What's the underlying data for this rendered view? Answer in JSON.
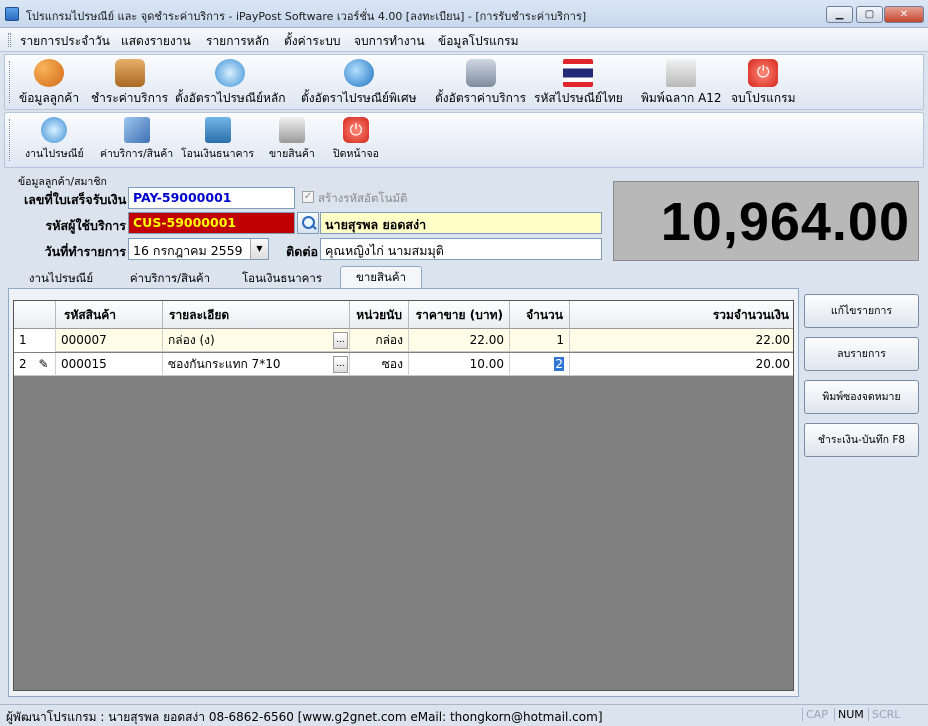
{
  "window": {
    "title": "โปรแกรมไปรษณีย์ และ จุดชำระค่าบริการ - iPayPost Software เวอร์ชั่น 4.00 [ลงทะเบียน] - [การรับชำระค่าบริการ]",
    "min_label": "▁",
    "max_label": "▢",
    "close_label": "✕"
  },
  "menu": [
    "รายการประจำวัน",
    "แสดงรายงาน",
    "รายการหลัก",
    "ตั้งค่าระบบ",
    "จบการทำงาน",
    "ข้อมูลโปรแกรม"
  ],
  "toolbar1": [
    {
      "label": "ข้อมูลลูกค้า",
      "icon": "customers-icon"
    },
    {
      "label": "ชำระค่าบริการ",
      "icon": "book-icon"
    },
    {
      "label": "ตั้งอัตราไปรษณีย์หลัก",
      "icon": "mail-icon"
    },
    {
      "label": "ตั้งอัตราไปรษณีย์พิเศษ",
      "icon": "globe-mail-icon"
    },
    {
      "label": "ตั้งอัตราค่าบริการ",
      "icon": "tap-icon"
    },
    {
      "label": "รหัสไปรษณีย์ไทย",
      "icon": "thai-flag-icon"
    },
    {
      "label": "พิมพ์ฉลาก A12",
      "icon": "envelope-icon"
    },
    {
      "label": "จบโปรแกรม",
      "icon": "power-icon"
    }
  ],
  "toolbar2": [
    {
      "label": "งานไปรษณีย์",
      "icon": "mail-icon"
    },
    {
      "label": "ค่าบริการ/สินค้า",
      "icon": "pencil-icon"
    },
    {
      "label": "โอนเงินธนาคาร",
      "icon": "network-icon"
    },
    {
      "label": "ขายสินค้า",
      "icon": "shop-icon"
    },
    {
      "label": "ปิดหน้าจอ",
      "icon": "power-icon"
    }
  ],
  "form": {
    "group_label": "ข้อมูลลูกค้า/สมาชิก",
    "receipt_label": "เลขที่ใบเสร็จรับเงิน",
    "receipt_value": "PAY-59000001",
    "auto_code_label": "สร้างรหัสอัตโนมัติ",
    "auto_code_checked": "✓",
    "customer_code_label": "รหัสผู้ใช้บริการ",
    "customer_code_value": "CUS-59000001",
    "customer_name": "นายสุรพล ยอดสง่า",
    "date_label": "วันที่ทำรายการ",
    "date_value": "16  กรกฎาคม   2559",
    "contact_label": "ติดต่อ",
    "contact_value": "คุณหญิงไก่ นามสมมุติ"
  },
  "total": "10,964.00",
  "tabs": [
    "งานไปรษณีย์",
    "ค่าบริการ/สินค้า",
    "โอนเงินธนาคาร",
    "ขายสินค้า"
  ],
  "active_tab": 3,
  "grid": {
    "columns": [
      "รหัสสินค้า",
      "รายละเอียด",
      "หน่วยนับ",
      "ราคาขาย (บาท)",
      "จำนวน",
      "รวมจำนวนเงิน"
    ],
    "rows": [
      {
        "no": "1",
        "edit_mark": "",
        "code": "000007",
        "desc": "กล่อง (ง)",
        "unit": "กล่อง",
        "price": "22.00",
        "qty": "1",
        "amount": "22.00"
      },
      {
        "no": "2",
        "edit_mark": "✎",
        "code": "000015",
        "desc": "ซองกันกระแทก 7*10",
        "unit": "ซอง",
        "price": "10.00",
        "qty": "2",
        "amount": "20.00"
      }
    ],
    "ellipsis": "..."
  },
  "side_buttons": [
    {
      "label": "แก้ไขรายการ"
    },
    {
      "label": "ลบรายการ"
    },
    {
      "label": "พิมพ์ซองจดหมาย"
    },
    {
      "label": "ชำระเงิน-บันทึก F8"
    }
  ],
  "status": {
    "text": "ผู้พัฒนาโปรแกรม : นายสุรพล ยอดสง่า 08-6862-6560  [www.g2gnet.com  eMail: thongkorn@hotmail.com]",
    "caps": "CAP",
    "num": "NUM",
    "scrl": "SCRL"
  },
  "colors": {
    "receipt_text": "#0000cc",
    "customer_code_bg": "#c00000",
    "customer_code_text": "#ffff00",
    "customer_name_bg": "#ffffc8",
    "total_bg": "#b8b8b8",
    "grid_bg": "#808080",
    "active_row_bg": "#fffde7"
  }
}
